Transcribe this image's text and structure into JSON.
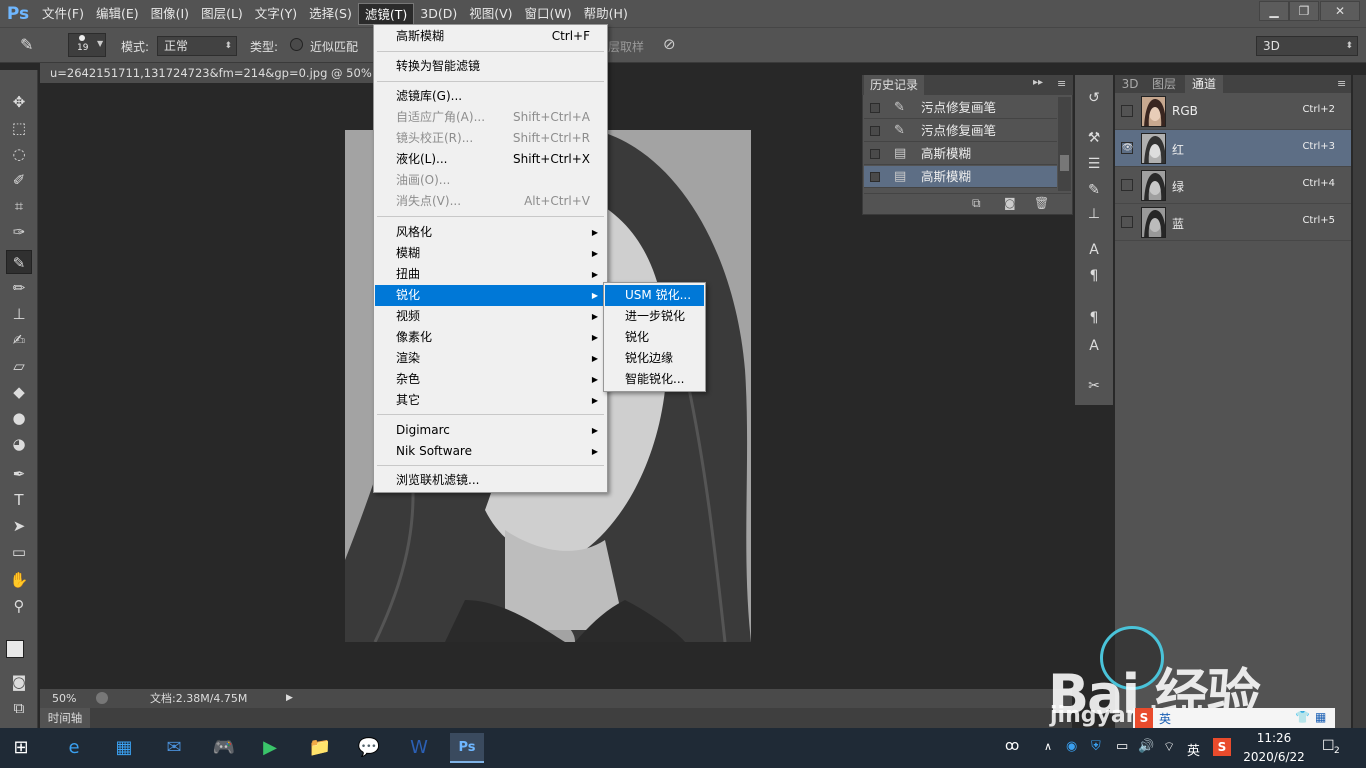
{
  "app": {
    "logo": "Ps"
  },
  "menubar": {
    "items": [
      "文件(F)",
      "编辑(E)",
      "图像(I)",
      "图层(L)",
      "文字(Y)",
      "选择(S)",
      "滤镜(T)",
      "3D(D)",
      "视图(V)",
      "窗口(W)",
      "帮助(H)"
    ],
    "active_index": 6
  },
  "window_controls": {
    "minimize": "▁",
    "restore": "❐",
    "close": "✕"
  },
  "options": {
    "brush_size": "19",
    "mode_label": "模式:",
    "mode_value": "正常",
    "type_label": "类型:",
    "type_option": "近似匹配",
    "sample_label": "层取样",
    "workspace": "3D"
  },
  "document": {
    "tab_title": "u=2642151711,131724723&fm=214&gp=0.jpg @ 50% (图层",
    "zoom": "50%",
    "doc_info": "文档:2.38M/4.75M",
    "timeline_label": "时间轴"
  },
  "filter_menu": {
    "items": [
      {
        "label": "高斯模糊",
        "shortcut": "Ctrl+F",
        "disabled": false
      },
      {
        "label": "转换为智能滤镜",
        "shortcut": "",
        "disabled": false
      },
      {
        "label": "滤镜库(G)...",
        "shortcut": "",
        "disabled": false
      },
      {
        "label": "自适应广角(A)...",
        "shortcut": "Shift+Ctrl+A",
        "disabled": true
      },
      {
        "label": "镜头校正(R)...",
        "shortcut": "Shift+Ctrl+R",
        "disabled": true
      },
      {
        "label": "液化(L)...",
        "shortcut": "Shift+Ctrl+X",
        "disabled": false
      },
      {
        "label": "油画(O)...",
        "shortcut": "",
        "disabled": true
      },
      {
        "label": "消失点(V)...",
        "shortcut": "Alt+Ctrl+V",
        "disabled": true
      },
      {
        "label": "风格化",
        "submenu": true
      },
      {
        "label": "模糊",
        "submenu": true
      },
      {
        "label": "扭曲",
        "submenu": true
      },
      {
        "label": "锐化",
        "submenu": true,
        "highlighted": true
      },
      {
        "label": "视频",
        "submenu": true
      },
      {
        "label": "像素化",
        "submenu": true
      },
      {
        "label": "渲染",
        "submenu": true
      },
      {
        "label": "杂色",
        "submenu": true
      },
      {
        "label": "其它",
        "submenu": true
      },
      {
        "label": "Digimarc",
        "submenu": true
      },
      {
        "label": "Nik Software",
        "submenu": true
      },
      {
        "label": "浏览联机滤镜...",
        "shortcut": ""
      }
    ]
  },
  "sharpen_submenu": {
    "items": [
      "USM 锐化...",
      "进一步锐化",
      "锐化",
      "锐化边缘",
      "智能锐化..."
    ],
    "highlighted_index": 0
  },
  "history": {
    "tab": "历史记录",
    "rows": [
      {
        "label": "污点修复画笔",
        "icon": "spot-healing-icon"
      },
      {
        "label": "污点修复画笔",
        "icon": "spot-healing-icon"
      },
      {
        "label": "高斯模糊",
        "icon": "document-icon"
      },
      {
        "label": "高斯模糊",
        "icon": "document-icon",
        "selected": true
      }
    ]
  },
  "channels": {
    "tabs": [
      "3D",
      "图层",
      "通道"
    ],
    "active_tab": 2,
    "rows": [
      {
        "name": "RGB",
        "shortcut": "Ctrl+2",
        "visible": false
      },
      {
        "name": "红",
        "shortcut": "Ctrl+3",
        "visible": true,
        "selected": true
      },
      {
        "name": "绿",
        "shortcut": "Ctrl+4",
        "visible": false
      },
      {
        "name": "蓝",
        "shortcut": "Ctrl+5",
        "visible": false
      }
    ]
  },
  "taskbar": {
    "ime": "英",
    "ime2": "英",
    "time": "11:26",
    "date": "2020/6/22",
    "notifications": "2"
  },
  "watermark": {
    "brand": "Bai  经验",
    "url": "jingyan.baidu.com"
  }
}
